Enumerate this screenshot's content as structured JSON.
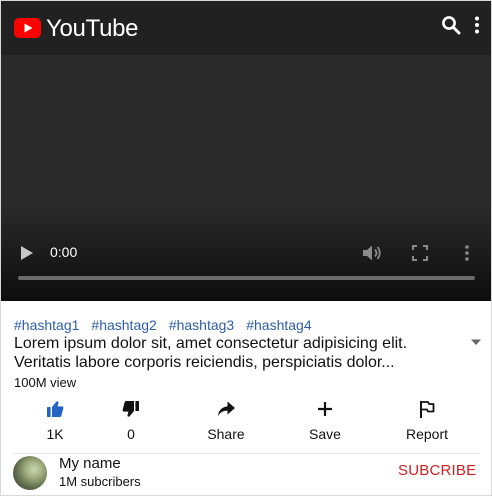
{
  "header": {
    "brand": "YouTube",
    "logo_icon": "youtube-play-logo-icon",
    "search_icon": "search-icon",
    "menu_icon": "more-vertical-icon"
  },
  "player": {
    "time": "0:00",
    "progress_fraction": 0,
    "controls": [
      "play-icon",
      "volume-icon",
      "fullscreen-icon",
      "more-vertical-icon"
    ]
  },
  "video": {
    "hashtags": [
      "#hashtag1",
      "#hashtag2",
      "#hashtag3",
      "#hashtag4"
    ],
    "description_line1": "Lorem ipsum dolor sit, amet consectetur adipisicing elit.",
    "description_line2": "Veritatis labore corporis reiciendis, perspiciatis dolor...",
    "views": "100M view"
  },
  "actions": [
    {
      "label": "1K",
      "icon": "thumbs-up-icon"
    },
    {
      "label": "0",
      "icon": "thumbs-down-icon"
    },
    {
      "label": "Share",
      "icon": "share-icon"
    },
    {
      "label": "Save",
      "icon": "plus-icon"
    },
    {
      "label": "Report",
      "icon": "flag-icon"
    }
  ],
  "channel": {
    "name": "My name",
    "subscribers": "1M subcribers",
    "subscribe_label": "SUBCRIBE"
  },
  "colors": {
    "topbar_bg": "#212121",
    "logo_red": "#ff0000",
    "hashtag_blue": "#2e5da8",
    "like_blue": "#2364c5",
    "subscribe_red": "#cc1f1f"
  }
}
